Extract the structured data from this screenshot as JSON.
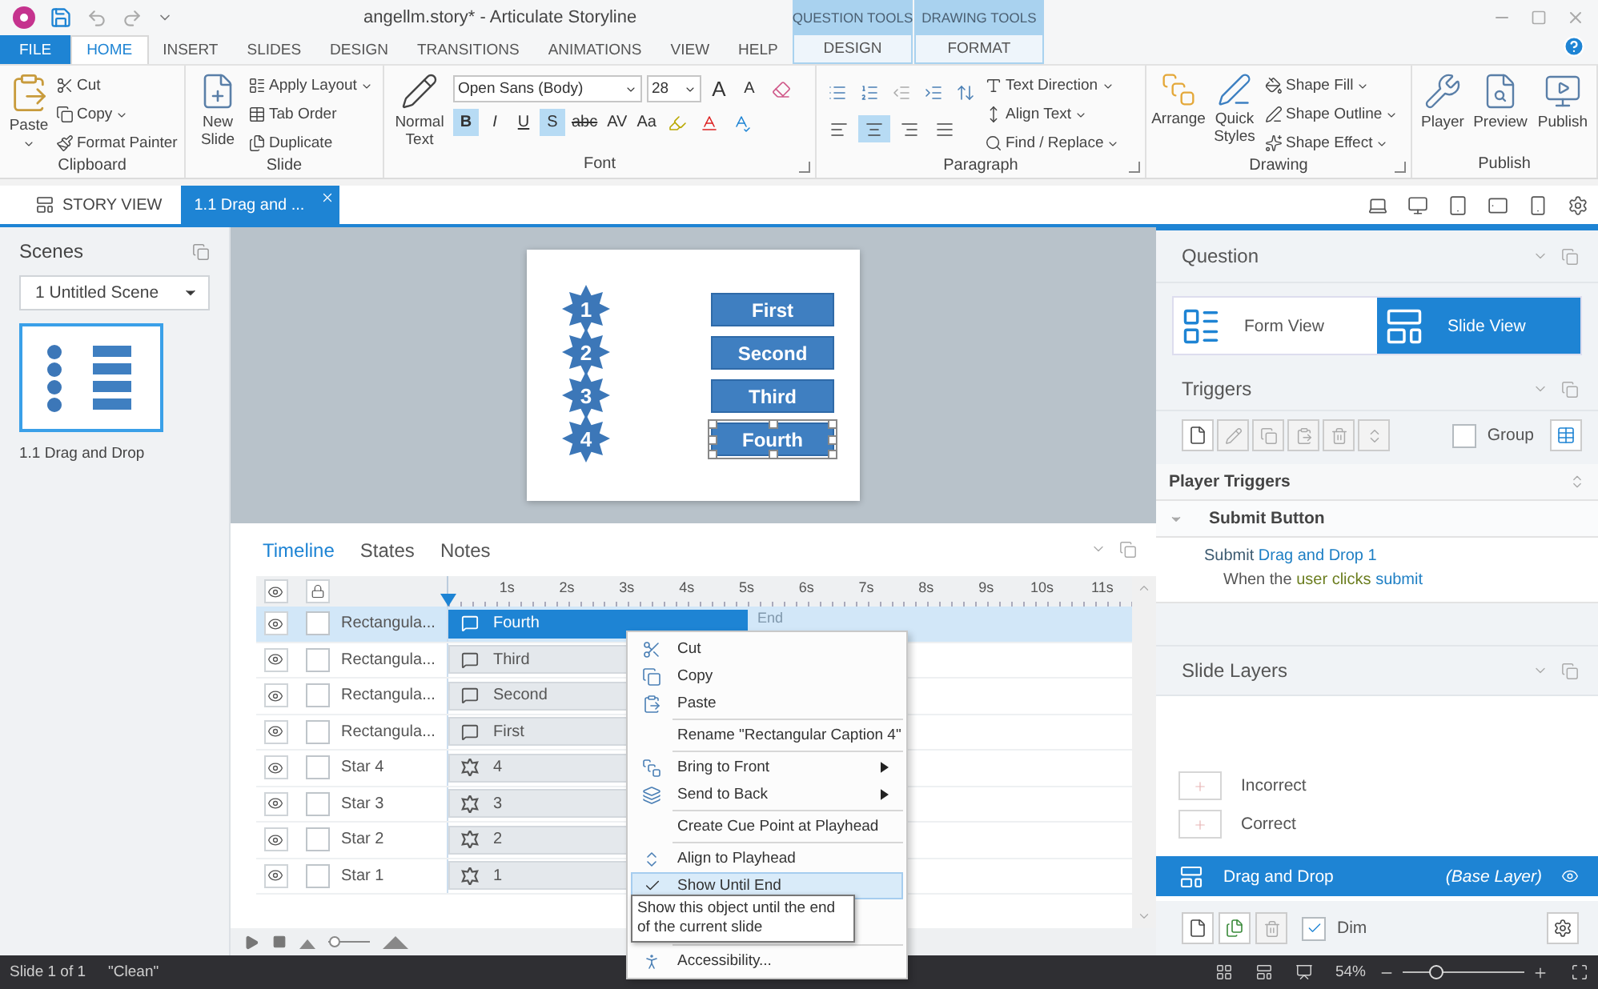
{
  "title_bar": {
    "title": "angellm.story* - Articulate Storyline",
    "context_groups": [
      {
        "label": "QUESTION TOOLS",
        "tab": {
          "label": "DESIGN",
          "selected": false
        }
      },
      {
        "label": "DRAWING TOOLS",
        "tab": {
          "label": "FORMAT",
          "selected": false
        }
      }
    ]
  },
  "ribbon_tabs": [
    {
      "label": "FILE",
      "kind": "file",
      "selected": false
    },
    {
      "label": "HOME",
      "kind": "tab",
      "selected": true
    },
    {
      "label": "INSERT",
      "kind": "tab",
      "selected": false
    },
    {
      "label": "SLIDES",
      "kind": "tab",
      "selected": false
    },
    {
      "label": "DESIGN",
      "kind": "tab",
      "selected": false
    },
    {
      "label": "TRANSITIONS",
      "kind": "tab",
      "selected": false
    },
    {
      "label": "ANIMATIONS",
      "kind": "tab",
      "selected": false
    },
    {
      "label": "VIEW",
      "kind": "tab",
      "selected": false
    },
    {
      "label": "HELP",
      "kind": "tab",
      "selected": false
    }
  ],
  "ribbon": {
    "clipboard": {
      "label": "Clipboard",
      "paste": "Paste",
      "items": [
        "Cut",
        "Copy",
        "Format Painter"
      ]
    },
    "slide": {
      "label": "Slide",
      "new_slide": "New Slide",
      "items": [
        "Apply Layout",
        "Tab Order",
        "Duplicate"
      ]
    },
    "font": {
      "label": "Font",
      "normal_text": "Normal Text",
      "font_name": "Open Sans (Body)",
      "font_size": "28",
      "size_buttons": [
        "A",
        "A"
      ],
      "format_buttons": [
        {
          "label": "B",
          "selected": true
        },
        {
          "label": "I",
          "selected": false
        },
        {
          "label": "U",
          "selected": false
        },
        {
          "label": "S",
          "selected": true
        },
        {
          "label": "abc",
          "selected": false
        },
        {
          "label": "AV",
          "selected": false
        },
        {
          "label": "Aa",
          "selected": false
        }
      ]
    },
    "paragraph": {
      "label": "Paragraph",
      "alignment": [
        {
          "kind": "left",
          "selected": false
        },
        {
          "kind": "center",
          "selected": true
        },
        {
          "kind": "right",
          "selected": false
        },
        {
          "kind": "justify",
          "selected": false
        }
      ],
      "items": [
        "Text Direction",
        "Align Text",
        "Find / Replace"
      ]
    },
    "drawing": {
      "label": "Drawing",
      "large": [
        "Arrange",
        "Quick Styles"
      ],
      "items": [
        "Shape Fill",
        "Shape Outline",
        "Shape Effect"
      ]
    },
    "publish": {
      "label": "Publish",
      "items": [
        "Player",
        "Preview",
        "Publish"
      ]
    }
  },
  "doc_tabs": [
    {
      "label": "STORY VIEW",
      "kind": "story",
      "selected": false
    },
    {
      "label": "1.1 Drag and ...",
      "kind": "slide",
      "selected": true
    }
  ],
  "scenes": {
    "title": "Scenes",
    "scene_select": "1 Untitled Scene",
    "thumbnail_label": "1.1 Drag and Drop"
  },
  "slide": {
    "stars": [
      "1",
      "2",
      "3",
      "4"
    ],
    "captions": [
      {
        "label": "First",
        "selected": false
      },
      {
        "label": "Second",
        "selected": false
      },
      {
        "label": "Third",
        "selected": false
      },
      {
        "label": "Fourth",
        "selected": true
      }
    ]
  },
  "timeline": {
    "tabs": [
      {
        "label": "Timeline",
        "selected": true
      },
      {
        "label": "States",
        "selected": false
      },
      {
        "label": "Notes",
        "selected": false
      }
    ],
    "ruler": [
      "1s",
      "2s",
      "3s",
      "4s",
      "5s",
      "6s",
      "7s",
      "8s",
      "9s",
      "10s",
      "11s"
    ],
    "end_label": "End",
    "rows": [
      {
        "name": "Rectangula...",
        "bar": "Fourth",
        "kind": "caption",
        "selected": true
      },
      {
        "name": "Rectangula...",
        "bar": "Third",
        "kind": "caption",
        "selected": false
      },
      {
        "name": "Rectangula...",
        "bar": "Second",
        "kind": "caption",
        "selected": false
      },
      {
        "name": "Rectangula...",
        "bar": "First",
        "kind": "caption",
        "selected": false
      },
      {
        "name": "Star 4",
        "bar": "4",
        "kind": "star",
        "selected": false
      },
      {
        "name": "Star 3",
        "bar": "3",
        "kind": "star",
        "selected": false
      },
      {
        "name": "Star 2",
        "bar": "2",
        "kind": "star",
        "selected": false
      },
      {
        "name": "Star 1",
        "bar": "1",
        "kind": "star",
        "selected": false
      }
    ],
    "zoom_slider": {
      "level": 0.15
    }
  },
  "context_menu": {
    "items": [
      {
        "kind": "item",
        "label": "Cut",
        "checked": false,
        "submenu": false,
        "selected": false
      },
      {
        "kind": "item",
        "label": "Copy",
        "checked": false,
        "submenu": false,
        "selected": false
      },
      {
        "kind": "item",
        "label": "Paste",
        "checked": false,
        "submenu": false,
        "selected": false
      },
      {
        "kind": "separator"
      },
      {
        "kind": "item",
        "label": "Rename \"Rectangular Caption 4\"",
        "checked": false,
        "submenu": false,
        "selected": false
      },
      {
        "kind": "separator"
      },
      {
        "kind": "item",
        "label": "Bring to Front",
        "checked": false,
        "submenu": true,
        "selected": false
      },
      {
        "kind": "item",
        "label": "Send to Back",
        "checked": false,
        "submenu": true,
        "selected": false
      },
      {
        "kind": "separator"
      },
      {
        "kind": "item",
        "label": "Create Cue Point at Playhead",
        "checked": false,
        "submenu": false,
        "selected": false
      },
      {
        "kind": "separator"
      },
      {
        "kind": "item",
        "label": "Align to Playhead",
        "checked": false,
        "submenu": false,
        "selected": false
      },
      {
        "kind": "item",
        "label": "Show Until End",
        "checked": true,
        "submenu": false,
        "selected": true
      },
      {
        "kind": "covered"
      },
      {
        "kind": "separator"
      },
      {
        "kind": "item",
        "label": "Accessibility...",
        "checked": false,
        "submenu": false,
        "selected": false
      }
    ]
  },
  "tooltip": "Show this object until the end of the current slide",
  "question": {
    "title": "Question",
    "views": [
      {
        "label": "Form View",
        "kind": "form",
        "selected": false
      },
      {
        "label": "Slide View",
        "kind": "slide",
        "selected": true
      }
    ]
  },
  "triggers": {
    "title": "Triggers",
    "group": {
      "label": "Group",
      "checked": false
    },
    "section": "Player Triggers",
    "object": {
      "label": "Submit Button",
      "expanded": true
    },
    "trigger": {
      "action": "Submit",
      "target": "Drag and Drop 1",
      "condition": [
        {
          "text": "When the",
          "kind": "plain"
        },
        {
          "text": "user clicks",
          "kind": "event"
        },
        {
          "text": "submit",
          "kind": "object"
        }
      ]
    }
  },
  "slide_layers": {
    "title": "Slide Layers",
    "layers": [
      {
        "name": "Incorrect",
        "kind": "layer",
        "selected": false
      },
      {
        "name": "Correct",
        "kind": "layer",
        "selected": false
      },
      {
        "name": "Drag and Drop",
        "note": "(Base Layer)",
        "kind": "base",
        "selected": true
      }
    ],
    "dim": {
      "label": "Dim",
      "checked": true
    }
  },
  "status_bar": {
    "slide": "Slide 1 of 1",
    "state": "\"Clean\"",
    "zoom": "54%",
    "zoom_slider": {
      "level": 0.28
    }
  }
}
